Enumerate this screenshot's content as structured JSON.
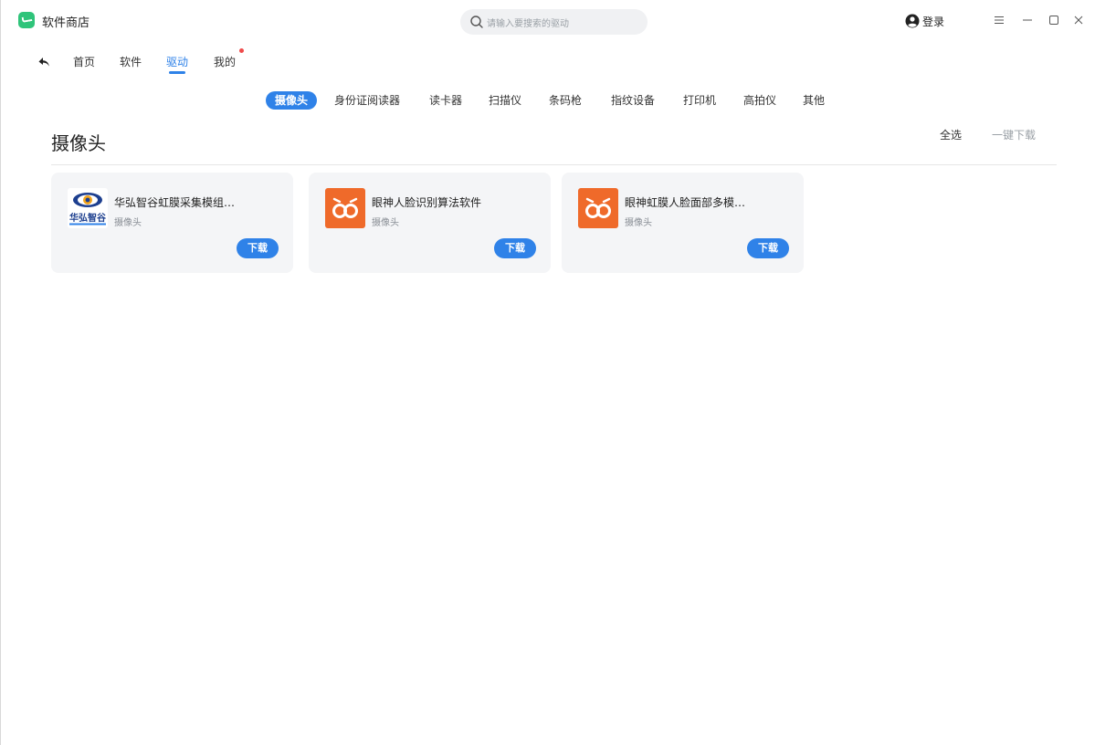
{
  "app": {
    "title": "软件商店"
  },
  "search": {
    "placeholder": "请输入要搜索的驱动"
  },
  "user": {
    "login_label": "登录"
  },
  "nav": {
    "items": [
      {
        "label": "首页"
      },
      {
        "label": "软件"
      },
      {
        "label": "驱动",
        "active": true
      },
      {
        "label": "我的",
        "has_notification": true
      }
    ]
  },
  "categories": [
    {
      "label": "摄像头",
      "active": true
    },
    {
      "label": "身份证阅读器"
    },
    {
      "label": "读卡器"
    },
    {
      "label": "扫描仪"
    },
    {
      "label": "条码枪"
    },
    {
      "label": "指纹设备"
    },
    {
      "label": "打印机"
    },
    {
      "label": "高拍仪"
    },
    {
      "label": "其他"
    }
  ],
  "section": {
    "title": "摄像头",
    "select_all_label": "全选",
    "download_all_label": "一键下载"
  },
  "drivers": [
    {
      "title": "华弘智谷虹膜采集模组…",
      "category": "摄像头",
      "button": "下载",
      "logo_text": "华弘智谷"
    },
    {
      "title": "眼神人脸识别算法软件",
      "category": "摄像头",
      "button": "下载"
    },
    {
      "title": "眼神虹膜人脸面部多模…",
      "category": "摄像头",
      "button": "下载"
    }
  ],
  "colors": {
    "accent": "#2f82e8",
    "app_logo": "#2fc47a",
    "orange_logo": "#ef6a2a",
    "notification": "#ef4b4b"
  }
}
